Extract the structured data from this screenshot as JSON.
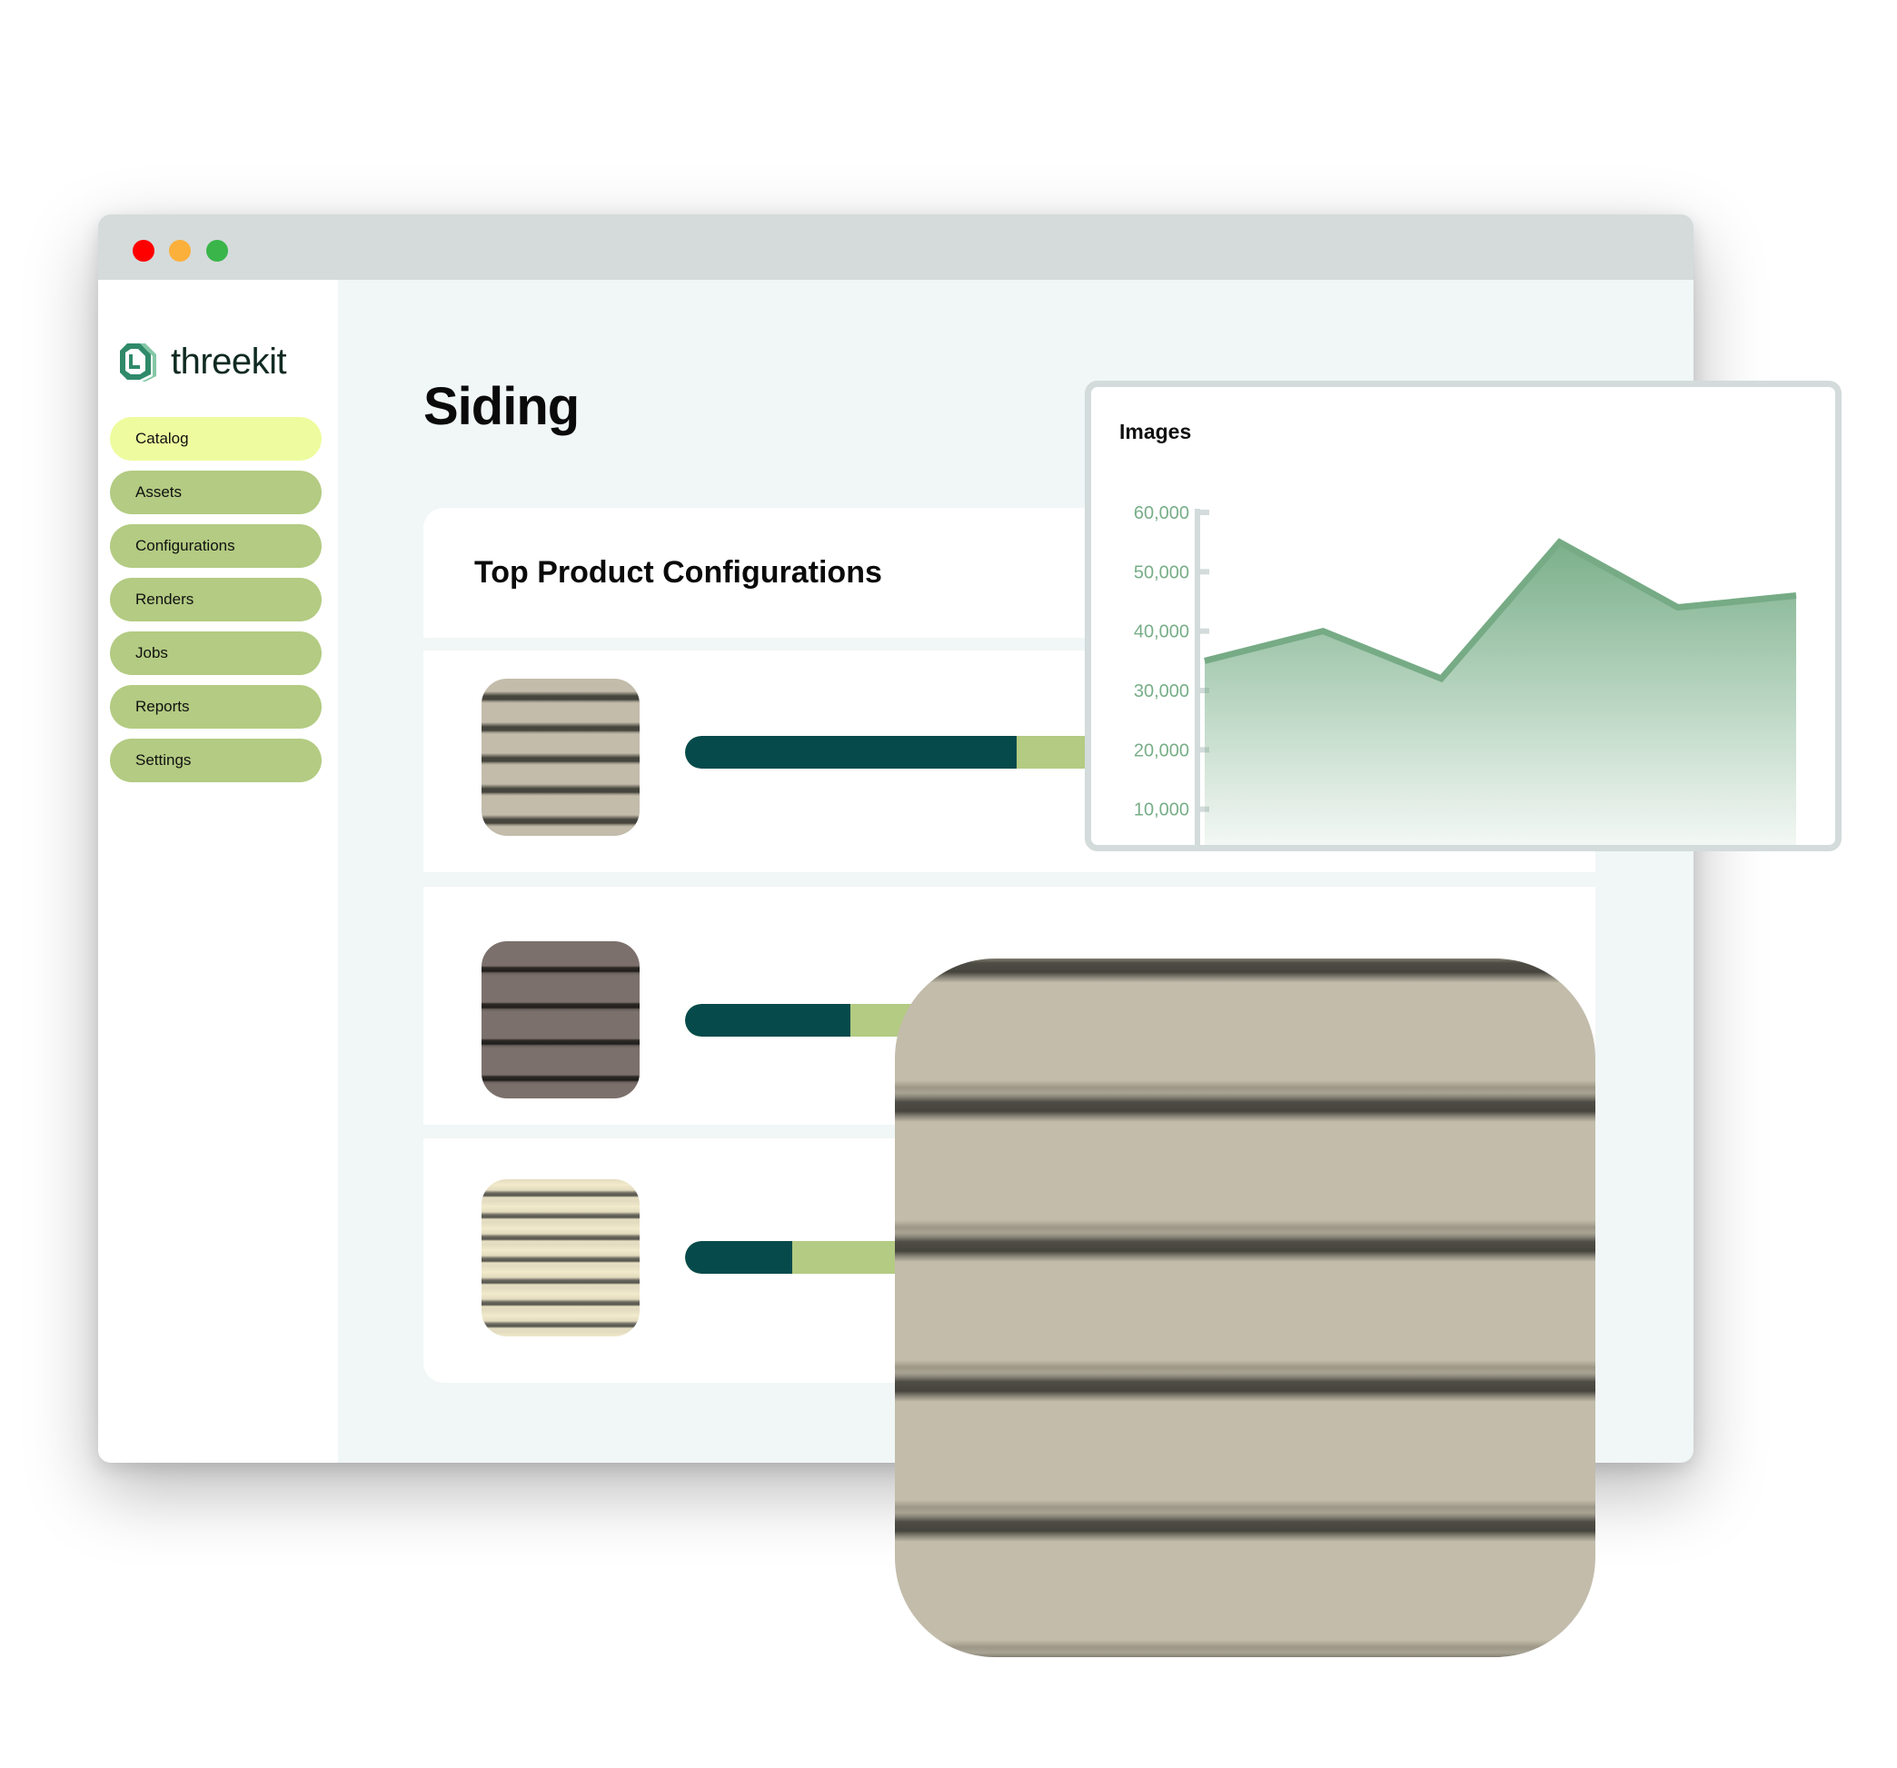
{
  "window": {
    "controls": [
      "close",
      "minimize",
      "maximize"
    ]
  },
  "brand": {
    "name": "threekit",
    "logo_icon": "threekit-hexagon-logo",
    "colors": {
      "accent_dark": "#064a4c",
      "accent_light": "#b3cb82",
      "nav_active": "#eefc9f",
      "chart_green": "#78ae88"
    }
  },
  "sidebar": {
    "items": [
      {
        "label": "Catalog",
        "active": true
      },
      {
        "label": "Assets",
        "active": false
      },
      {
        "label": "Configurations",
        "active": false
      },
      {
        "label": "Renders",
        "active": false
      },
      {
        "label": "Jobs",
        "active": false
      },
      {
        "label": "Reports",
        "active": false
      },
      {
        "label": "Settings",
        "active": false
      }
    ]
  },
  "main": {
    "page_title": "Siding",
    "card_title": "Top Product Configurations",
    "products": [
      {
        "swatch": "beige-siding",
        "share": 0.48
      },
      {
        "swatch": "brown-siding",
        "share": 0.24
      },
      {
        "swatch": "cream-siding",
        "share": 0.155
      }
    ]
  },
  "featured_swatch": "beige-siding",
  "chart_data": {
    "type": "area",
    "title": "Images",
    "xlabel": "",
    "ylabel": "",
    "x": [
      1,
      2,
      3,
      4,
      5,
      6
    ],
    "values": [
      35000,
      40000,
      32000,
      55000,
      44000,
      46000
    ],
    "ylim": [
      0,
      60000
    ],
    "yticks": [
      10000,
      20000,
      30000,
      40000,
      50000,
      60000
    ],
    "ytick_labels": [
      "10,000",
      "20,000",
      "30,000",
      "40,000",
      "50,000",
      "60,000"
    ],
    "grid": false,
    "legend": "none"
  }
}
